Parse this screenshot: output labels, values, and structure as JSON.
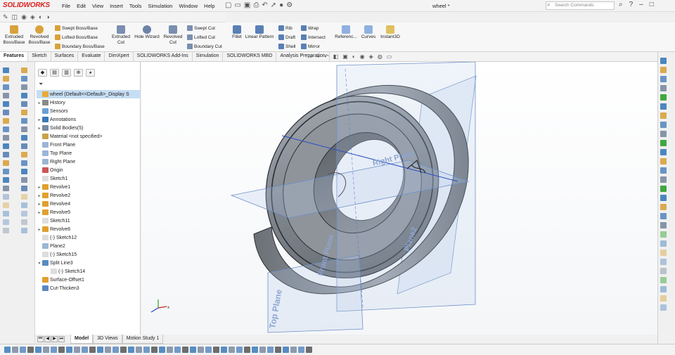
{
  "app": {
    "logo_text": "SOLIDWORKS",
    "doc_title": "wheel *"
  },
  "menu": [
    "File",
    "Edit",
    "View",
    "Insert",
    "Tools",
    "Simulation",
    "Window",
    "Help"
  ],
  "search": {
    "placeholder": "Search Commands"
  },
  "ribbon": {
    "extruded_boss": "Extruded Boss/Base",
    "revolved_boss": "Revolved Boss/Base",
    "swept_boss": "Swept Boss/Base",
    "lofted_boss": "Lofted Boss/Base",
    "boundary_boss": "Boundary Boss/Base",
    "extruded_cut": "Extruded Cut",
    "hole_wizard": "Hole Wizard",
    "revolved_cut": "Revolved Cut",
    "swept_cut": "Swept Cut",
    "lofted_cut": "Lofted Cut",
    "boundary_cut": "Boundary Cut",
    "fillet": "Fillet",
    "linear_pattern": "Linear Pattern",
    "rib": "Rib",
    "draft": "Draft",
    "shell": "Shell",
    "wrap": "Wrap",
    "intersect": "Intersect",
    "mirror": "Mirror",
    "reference": "Referenc...",
    "curves": "Curves",
    "instant3d": "Instant3D"
  },
  "tabs": [
    "Features",
    "Sketch",
    "Surfaces",
    "Evaluate",
    "DimXpert",
    "SOLIDWORKS Add-Ins",
    "Simulation",
    "SOLIDWORKS MBD",
    "Analysis Preparation"
  ],
  "tree": [
    {
      "label": "wheel  (Default<<Default>_Display S",
      "exp": "",
      "color": "#e8a93a",
      "sel": true
    },
    {
      "label": "History",
      "exp": "▸",
      "color": "#8a8a8a"
    },
    {
      "label": "Sensors",
      "exp": "",
      "color": "#6aa0d8"
    },
    {
      "label": "Annotations",
      "exp": "▸",
      "color": "#3a7ab8"
    },
    {
      "label": "Solid Bodies(5)",
      "exp": "▸",
      "color": "#7a8aa0"
    },
    {
      "label": "Material <not specified>",
      "exp": "",
      "color": "#c9a34a"
    },
    {
      "label": "Front Plane",
      "exp": "",
      "color": "#9bb5d6"
    },
    {
      "label": "Top Plane",
      "exp": "",
      "color": "#9bb5d6"
    },
    {
      "label": "Right Plane",
      "exp": "",
      "color": "#9bb5d6"
    },
    {
      "label": "Origin",
      "exp": "",
      "color": "#c55"
    },
    {
      "label": "Sketch1",
      "exp": "",
      "color": "#dddddd"
    },
    {
      "label": "Revolve1",
      "exp": "▸",
      "color": "#e0a030"
    },
    {
      "label": "Revolve2",
      "exp": "▸",
      "color": "#e0a030"
    },
    {
      "label": "Revolve4",
      "exp": "▸",
      "color": "#e0a030"
    },
    {
      "label": "Revolve5",
      "exp": "▸",
      "color": "#e0a030"
    },
    {
      "label": "Sketch11",
      "exp": "",
      "color": "#dddddd"
    },
    {
      "label": "Revolve6",
      "exp": "▸",
      "color": "#e0a030"
    },
    {
      "label": "(-) Sketch12",
      "exp": "",
      "color": "#dddddd"
    },
    {
      "label": "Plane2",
      "exp": "",
      "color": "#9bb5d6"
    },
    {
      "label": "(-) Sketch15",
      "exp": "",
      "color": "#dddddd"
    },
    {
      "label": "Split Line3",
      "exp": "▾",
      "color": "#5a8ac0"
    },
    {
      "label": "(-) Sketch14",
      "exp": "",
      "color": "#dddddd",
      "indent": true
    },
    {
      "label": "Surface-Offset1",
      "exp": "",
      "color": "#e0a030"
    },
    {
      "label": "Cut-Thicken3",
      "exp": "",
      "color": "#5a8ac0"
    }
  ],
  "bottom_tabs": [
    "Model",
    "3D Views",
    "Motion Study 1"
  ],
  "viewport": {
    "plane_labels": [
      "Right Plane",
      "Front Plane",
      "Plane2",
      "Top Plane"
    ]
  },
  "colors": {
    "accent": "#2a63c7",
    "plane": "#9db9e8",
    "body": "#8e949c"
  }
}
